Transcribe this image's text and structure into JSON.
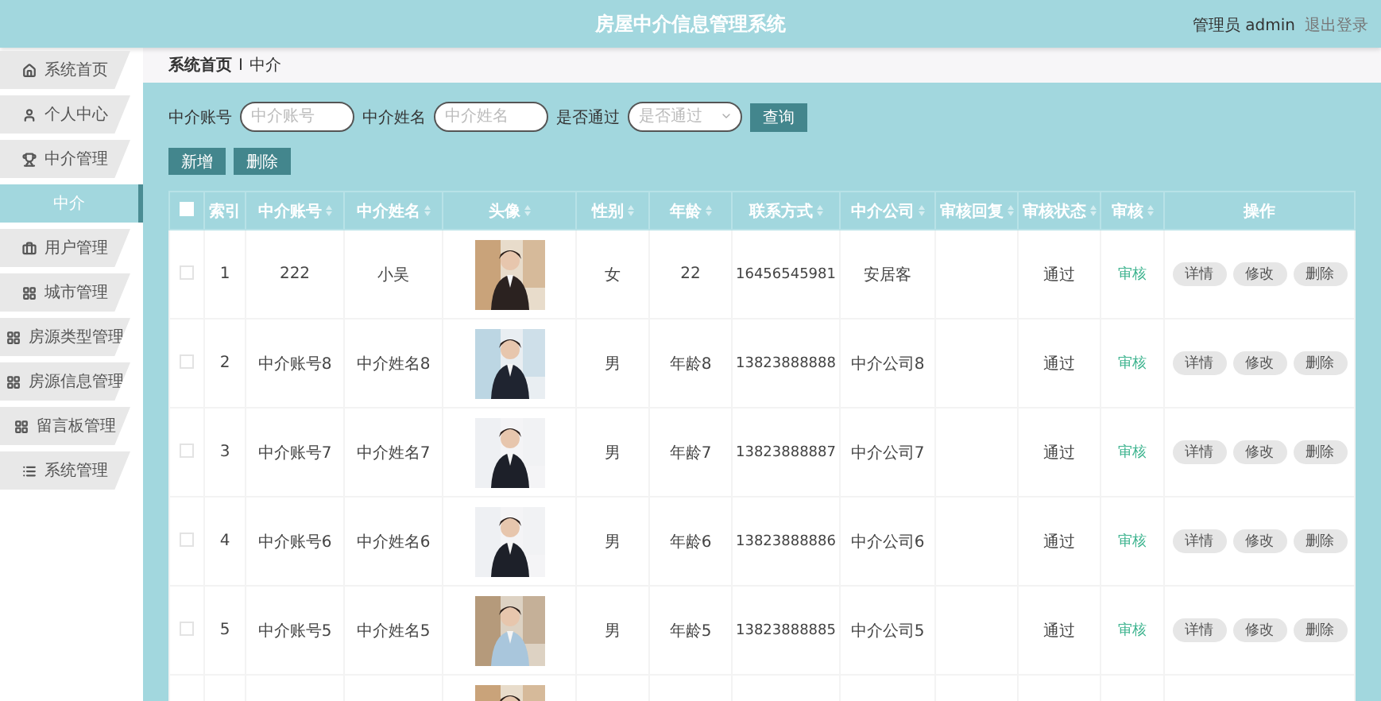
{
  "header": {
    "title": "房屋中介信息管理系统",
    "user": "管理员 admin",
    "logout": "退出登录"
  },
  "sidebar": {
    "items": [
      {
        "label": "系统首页",
        "selected": false
      },
      {
        "label": "个人中心",
        "selected": false
      },
      {
        "label": "中介管理",
        "selected": false,
        "expanded": true,
        "children": [
          {
            "label": "中介",
            "selected": true
          }
        ]
      },
      {
        "label": "用户管理",
        "selected": false
      },
      {
        "label": "城市管理",
        "selected": false
      },
      {
        "label": "房源类型管理",
        "selected": false
      },
      {
        "label": "房源信息管理",
        "selected": false
      },
      {
        "label": "留言板管理",
        "selected": false
      },
      {
        "label": "系统管理",
        "selected": false
      }
    ]
  },
  "breadcrumb": {
    "items": [
      "系统首页",
      "中介"
    ],
    "separator": "I"
  },
  "search": {
    "fields": [
      {
        "label": "中介账号",
        "placeholder": "中介账号",
        "kind": "text"
      },
      {
        "label": "中介姓名",
        "placeholder": "中介姓名",
        "kind": "text"
      },
      {
        "label": "是否通过",
        "placeholder": "是否通过",
        "kind": "select"
      }
    ],
    "button": "查询"
  },
  "actions": [
    "新增",
    "删除"
  ],
  "table": {
    "select_all": {
      "checked": false
    },
    "columns": [
      {
        "label": "索引",
        "sortable": false
      },
      {
        "label": "中介账号",
        "sortable": true
      },
      {
        "label": "中介姓名",
        "sortable": true
      },
      {
        "label": "头像",
        "sortable": true
      },
      {
        "label": "性别",
        "sortable": true
      },
      {
        "label": "年龄",
        "sortable": true
      },
      {
        "label": "联系方式",
        "sortable": true
      },
      {
        "label": "中介公司",
        "sortable": true
      },
      {
        "label": "审核回复",
        "sortable": true
      },
      {
        "label": "审核状态",
        "sortable": true
      },
      {
        "label": "审核",
        "sortable": true
      },
      {
        "label": "操作",
        "sortable": false
      }
    ],
    "rows": [
      {
        "checked": false,
        "index": "1",
        "account": "222",
        "name": "小吴",
        "gender": "女",
        "age": "22",
        "phone": "16456545981",
        "company": "安居客",
        "status": "通过",
        "audit": "审核",
        "actions": [
          "详情",
          "修改",
          "删除"
        ]
      },
      {
        "checked": false,
        "index": "2",
        "account": "中介账号8",
        "name": "中介姓名8",
        "gender": "男",
        "age": "年龄8",
        "phone": "13823888888",
        "company": "中介公司8",
        "status": "通过",
        "audit": "审核",
        "actions": [
          "详情",
          "修改",
          "删除"
        ]
      },
      {
        "checked": false,
        "index": "3",
        "account": "中介账号7",
        "name": "中介姓名7",
        "gender": "男",
        "age": "年龄7",
        "phone": "13823888887",
        "company": "中介公司7",
        "status": "通过",
        "audit": "审核",
        "actions": [
          "详情",
          "修改",
          "删除"
        ]
      },
      {
        "checked": false,
        "index": "4",
        "account": "中介账号6",
        "name": "中介姓名6",
        "gender": "男",
        "age": "年龄6",
        "phone": "13823888886",
        "company": "中介公司6",
        "status": "通过",
        "audit": "审核",
        "actions": [
          "详情",
          "修改",
          "删除"
        ]
      },
      {
        "checked": false,
        "index": "5",
        "account": "中介账号5",
        "name": "中介姓名5",
        "gender": "男",
        "age": "年龄5",
        "phone": "13823888885",
        "company": "中介公司5",
        "status": "通过",
        "audit": "审核",
        "actions": [
          "详情",
          "修改",
          "删除"
        ]
      }
    ]
  }
}
